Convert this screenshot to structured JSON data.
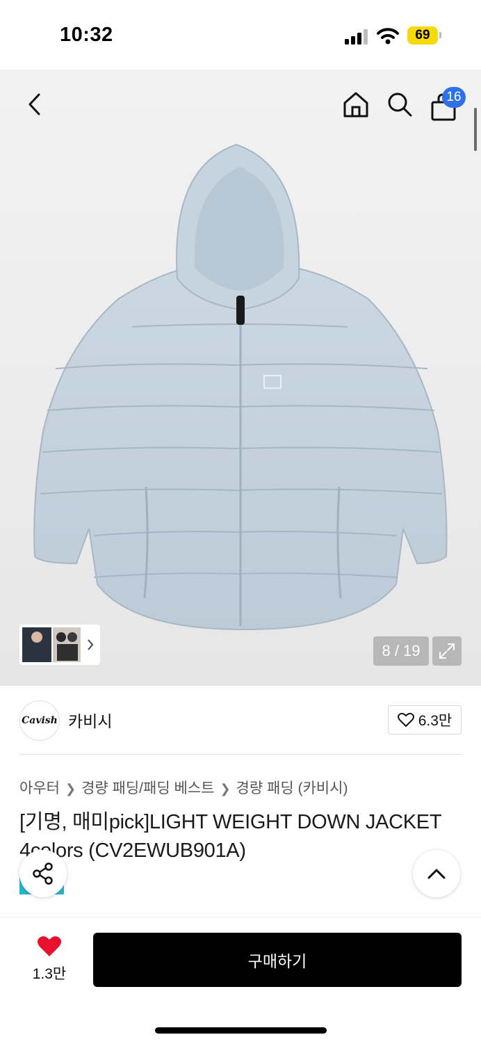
{
  "status_bar": {
    "time": "10:32",
    "battery": "69"
  },
  "header": {
    "cart_count": "16"
  },
  "gallery": {
    "counter": "8 / 19"
  },
  "brand": {
    "logo_text": "Cavish",
    "name": "카비시",
    "likes": "6.3만"
  },
  "breadcrumb": [
    "아우터",
    "경량 패딩/패딩 베스트",
    "경량 패딩 (카비시)"
  ],
  "product": {
    "title": "[기명, 매미pick]LIGHT WEIGHT DOWN JACKET 4colors (CV2EWUB901A)"
  },
  "bottom_bar": {
    "wish_count": "1.3만",
    "buy_label": "구매하기"
  },
  "colors": {
    "accent": "#2f6fe8",
    "heart": "#e8112d",
    "jacket": "#c5d3df",
    "battery": "#f5d90a"
  }
}
